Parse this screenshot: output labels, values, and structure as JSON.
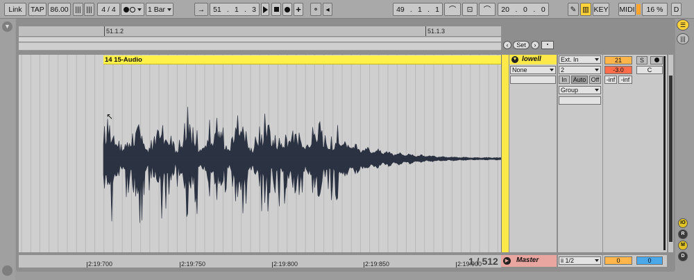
{
  "topbar": {
    "link": "Link",
    "tap": "TAP",
    "tempo": "86.00",
    "meter": "4 / 4",
    "quant": "1 Bar",
    "position": [
      "51",
      "1",
      "3"
    ],
    "loop_start": [
      "49",
      "1",
      "1"
    ],
    "loop_length": [
      "20",
      "0",
      "0"
    ],
    "key": "KEY",
    "midi": "MIDI",
    "cpu": "16 %",
    "d": "D"
  },
  "ruler": {
    "tick1": "51.1.2",
    "tick2": "51.1.3"
  },
  "set_label": "Set",
  "clip": {
    "title": "14 15-Audio"
  },
  "track": {
    "name": "lowell",
    "monitor_input": "None",
    "input_type": "Ext. In",
    "input_channel": "2",
    "monitor": [
      "In",
      "Auto",
      "Off"
    ],
    "output": "Group",
    "track_number": "21",
    "solo": "S",
    "volume": "-3.0",
    "pan": "C",
    "peak_l": "-inf",
    "peak_r": "-inf"
  },
  "master": {
    "name": "Master",
    "cue": "ii 1/2",
    "vol_l": "0",
    "vol_r": "0"
  },
  "zoom": "1 / 512",
  "time_ruler": [
    "2:19:700",
    "2:19:750",
    "2:19:800",
    "2:19:850",
    "2:19:900"
  ],
  "right_buttons": [
    "IO",
    "R",
    "M",
    "D"
  ],
  "colors": {
    "clip": "#fff14a",
    "track_header": "#ffe94a",
    "waveform": "#2b3242",
    "orange": "#ffa52e"
  }
}
